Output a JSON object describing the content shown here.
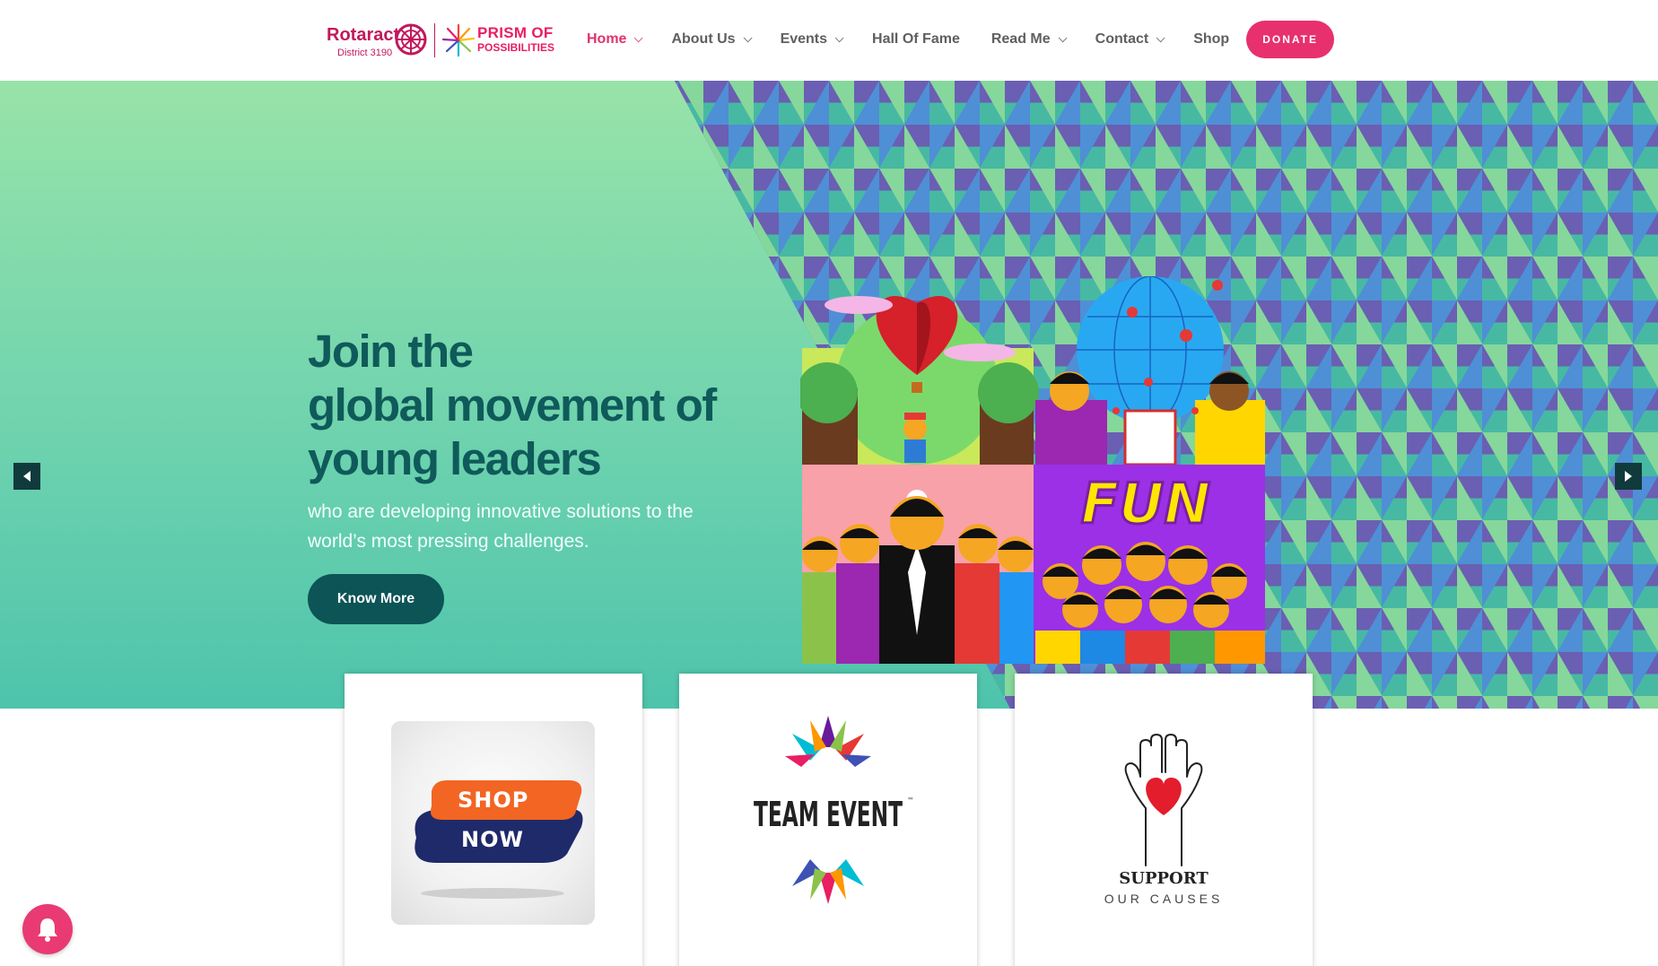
{
  "header": {
    "logo": {
      "rotaract": "Rotaract",
      "district": "District 3190",
      "prism_line1": "PRISM OF",
      "prism_line2": "POSSIBILITIES"
    },
    "nav": [
      {
        "label": "Home",
        "has_dropdown": true,
        "active": true
      },
      {
        "label": "About Us",
        "has_dropdown": true
      },
      {
        "label": "Events",
        "has_dropdown": true
      },
      {
        "label": "Hall Of Fame",
        "has_dropdown": false
      },
      {
        "label": "Read Me",
        "has_dropdown": true
      },
      {
        "label": "Contact",
        "has_dropdown": true
      },
      {
        "label": "Shop",
        "has_dropdown": false
      }
    ],
    "donate_label": "DONATE"
  },
  "hero": {
    "title_lines": [
      "Join the",
      "global movement of",
      "young leaders"
    ],
    "subtitle": "who are developing innovative solutions to the world’s most pressing challenges.",
    "button_label": "Know More",
    "illustration_text": "FUN"
  },
  "cards": {
    "shop": {
      "line1": "SHOP",
      "line2": "NOW"
    },
    "team": {
      "label": "TEAM EVENT",
      "tm": "™"
    },
    "support": {
      "line1": "SUPPORT",
      "line2": "OUR CAUSES"
    }
  },
  "colors": {
    "brand_pink": "#e8306e",
    "hero_dark_teal": "#0c5456",
    "rotaract_magenta": "#c2185b"
  },
  "icons": {
    "prev": "chevron-left-icon",
    "next": "chevron-right-icon",
    "notification": "bell-icon"
  }
}
